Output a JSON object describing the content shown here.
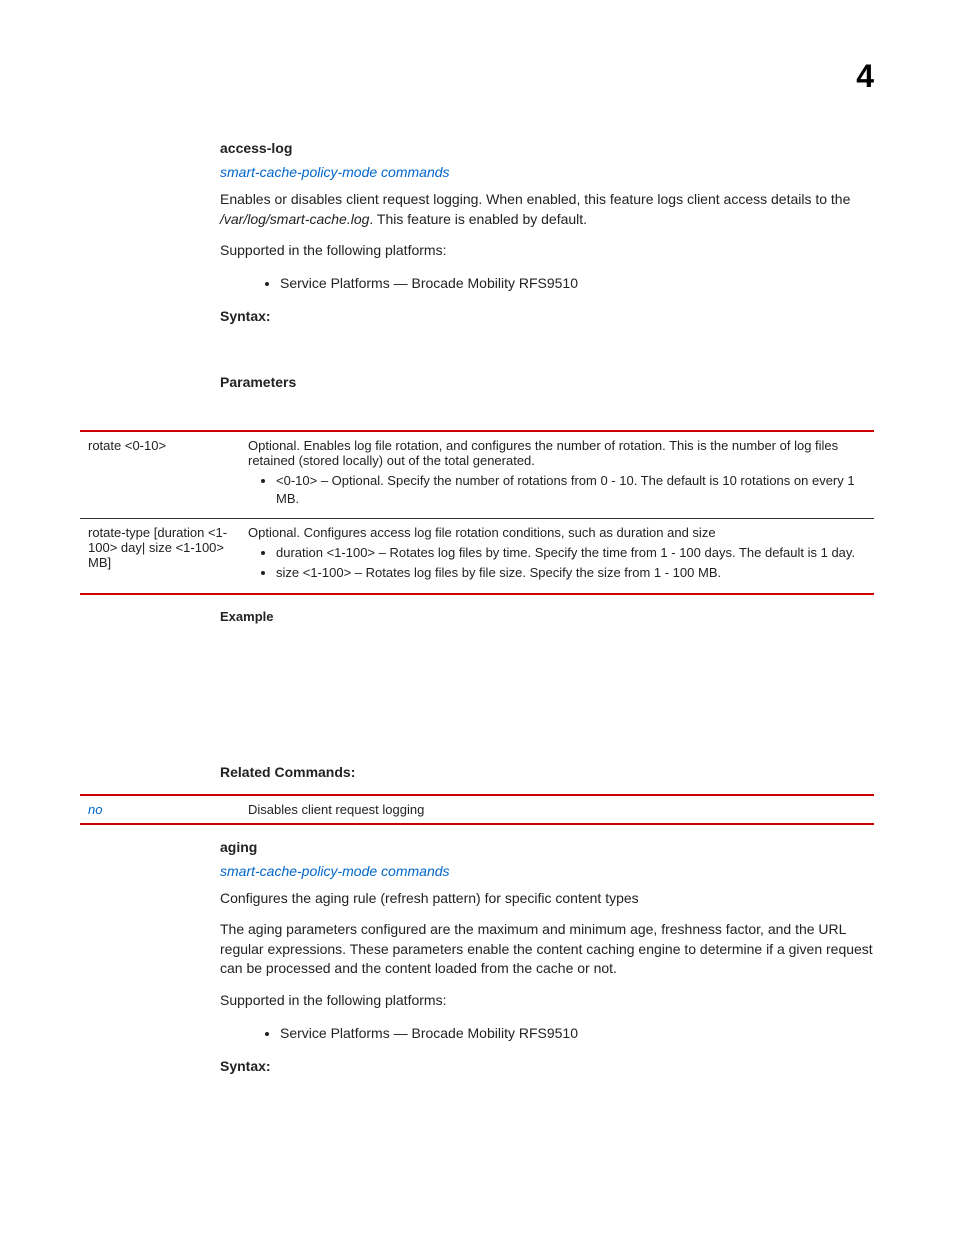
{
  "page_number": "4",
  "section1": {
    "title": "access-log",
    "link": "smart-cache-policy-mode commands",
    "para1_a": "Enables or disables client request logging. When enabled, this feature logs client access details to the ",
    "para1_b": "/var/log/smart-cache.log",
    "para1_c": ". This feature is enabled by default.",
    "supported": "Supported in the following platforms:",
    "platform": "Service Platforms — Brocade Mobility RFS9510",
    "syntax": "Syntax:",
    "params_head": "Parameters",
    "row1_left": "rotate <0-10>",
    "row1_desc": "Optional. Enables log file rotation, and configures the number of rotation. This is the number of log files retained (stored locally) out of the total generated.",
    "row1_bullet": "<0-10> – Optional. Specify the number of rotations from 0 - 10. The default is 10 rotations on every 1 MB.",
    "row2_left": "rotate-type [duration <1-100> day| size <1-100> MB]",
    "row2_desc": "Optional. Configures access log file rotation conditions, such as duration and size",
    "row2_b1": "duration <1-100> – Rotates log files by time. Specify the time from 1 - 100 days. The default is 1 day.",
    "row2_b2": "size <1-100> – Rotates log files by file size. Specify the size from 1 - 100 MB.",
    "example": "Example",
    "related_head": "Related Commands:",
    "rel_left": "no",
    "rel_right": "Disables client request logging"
  },
  "section2": {
    "title": "aging",
    "link": "smart-cache-policy-mode commands",
    "para1": "Configures the aging rule (refresh pattern) for specific content types",
    "para2": "The aging parameters configured are the maximum and minimum age, freshness factor, and the URL regular expressions. These parameters enable the content caching engine to determine if a given request can be processed and the content loaded from the cache or not.",
    "supported": "Supported in the following platforms:",
    "platform": "Service Platforms — Brocade Mobility RFS9510",
    "syntax": "Syntax:"
  }
}
